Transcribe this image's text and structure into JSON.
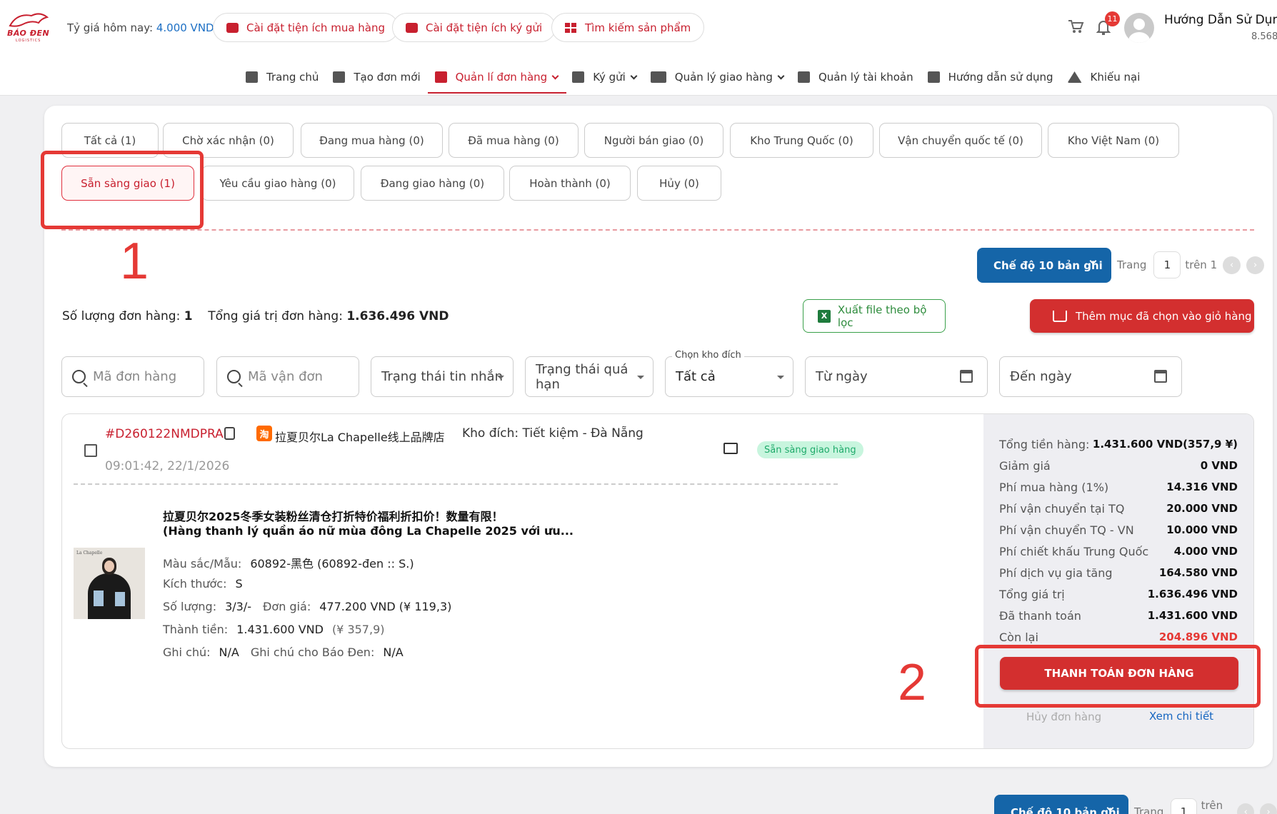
{
  "header": {
    "logo_text": "BÁO ĐEN",
    "logo_sub": "LOGISTICS",
    "rate_label": "Tỷ giá hôm nay:",
    "rate_value": "4.000 VND",
    "pills": [
      "Cài đặt tiện ích mua hàng",
      "Cài đặt tiện ích ký gửi",
      "Tìm kiếm sản phẩm"
    ],
    "notification_count": "11",
    "user_name": "Hướng Dẫn Sử Dụng",
    "user_balance": "8.568"
  },
  "nav": {
    "items": [
      {
        "label": "Trang chủ",
        "icon": "home-icon"
      },
      {
        "label": "Tạo đơn mới",
        "icon": "plus-square-icon"
      },
      {
        "label": "Quản lí đơn hàng",
        "icon": "cart-icon"
      },
      {
        "label": "Ký gửi",
        "icon": "box-icon"
      },
      {
        "label": "Quản lý giao hàng",
        "icon": "truck-icon"
      },
      {
        "label": "Quản lý tài khoản",
        "icon": "account-icon"
      },
      {
        "label": "Hướng dẫn sử dụng",
        "icon": "document-icon"
      },
      {
        "label": "Khiếu nại",
        "icon": "warning-icon"
      }
    ]
  },
  "tabs": [
    "Tất cả (1)",
    "Chờ xác nhận (0)",
    "Đang mua hàng (0)",
    "Đã mua hàng (0)",
    "Người bán giao (0)",
    "Kho Trung Quốc (0)",
    "Vận chuyển quốc tế (0)",
    "Kho Việt Nam (0)",
    "Sẵn sàng giao (1)",
    "Yêu cầu giao hàng (0)",
    "Đang giao hàng (0)",
    "Hoàn thành (0)",
    "Hủy (0)"
  ],
  "annotations": {
    "step1": "1",
    "step2": "2"
  },
  "pager": {
    "mode": "Chế độ 10 bản ghi",
    "page_label": "Trang",
    "page": "1",
    "of": "trên 1"
  },
  "summary": {
    "count_label": "Số lượng đơn hàng:",
    "count": "1",
    "total_label": "Tổng giá trị đơn hàng:",
    "total": "1.636.496 VND"
  },
  "actions": {
    "export": "Xuất file theo bộ lọc",
    "add_cart": "Thêm mục đã chọn vào giỏ hàng"
  },
  "filters": {
    "order_code": "Mã đơn hàng",
    "tracking_code": "Mã vận đơn",
    "message_status": "Trạng thái tin nhắn",
    "overdue_status": "Trạng thái quá hạn",
    "warehouse_label": "Chọn kho đích",
    "warehouse_value": "Tất cả",
    "from_date": "Từ ngày",
    "to_date": "Đến ngày"
  },
  "order": {
    "id": "#D260122NMDPRA",
    "shop_badge": "淘",
    "shop": "拉夏贝尔La Chapelle线上品牌店",
    "warehouse": "Kho đích: Tiết kiệm - Đà Nẵng",
    "status": "Sẵn sàng giao hàng",
    "time": "09:01:42, 22/1/2026",
    "image_brand": "La Chapelle",
    "product_title_1": "拉夏贝尔2025冬季女装粉丝清仓打折特价福利折扣价！数量有限！",
    "product_title_2": "(Hàng thanh lý quần áo nữ mùa đông La Chapelle 2025 với ưu...",
    "color_label": "Màu sắc/Mẫu:",
    "color": "60892-黑色 (60892-đen :: S.)",
    "size_label": "Kích thước:",
    "size": "S",
    "qty_label": "Số lượng:",
    "qty": "3/3/-",
    "price_label": "Đơn giá:",
    "price": "477.200 VND (¥ 119,3)",
    "amount_label": "Thành tiền:",
    "amount": "1.431.600 VND",
    "amount_cny": "(¥ 357,9)",
    "note_label": "Ghi chú:",
    "note": "N/A",
    "note2_label": "Ghi chú cho Báo Đen:",
    "note2": "N/A"
  },
  "fees": [
    {
      "label": "Tổng tiền hàng:",
      "value": "1.431.600 VND(357,9 ¥)"
    },
    {
      "label": "Giảm giá",
      "value": "0 VND"
    },
    {
      "label": "Phí mua hàng (1%)",
      "value": "14.316 VND"
    },
    {
      "label": "Phí vận chuyển tại TQ",
      "value": "20.000 VND"
    },
    {
      "label": "Phí vận chuyển TQ - VN",
      "value": "10.000 VND"
    },
    {
      "label": "Phí chiết khấu Trung Quốc",
      "value": "4.000 VND"
    },
    {
      "label": "Phí dịch vụ gia tăng",
      "value": "164.580 VND"
    },
    {
      "label": "Tổng giá trị",
      "value": "1.636.496 VND"
    },
    {
      "label": "Đã thanh toán",
      "value": "1.431.600 VND"
    },
    {
      "label": "Còn lại",
      "value": "204.896 VND"
    }
  ],
  "order_actions": {
    "pay": "THANH TOÁN ĐƠN HÀNG",
    "cancel": "Hủy đơn hàng",
    "detail": "Xem chi tiết"
  },
  "colors": {
    "brand_red": "#c8202f",
    "primary_blue": "#1565a8",
    "highlight": "#e53935"
  }
}
